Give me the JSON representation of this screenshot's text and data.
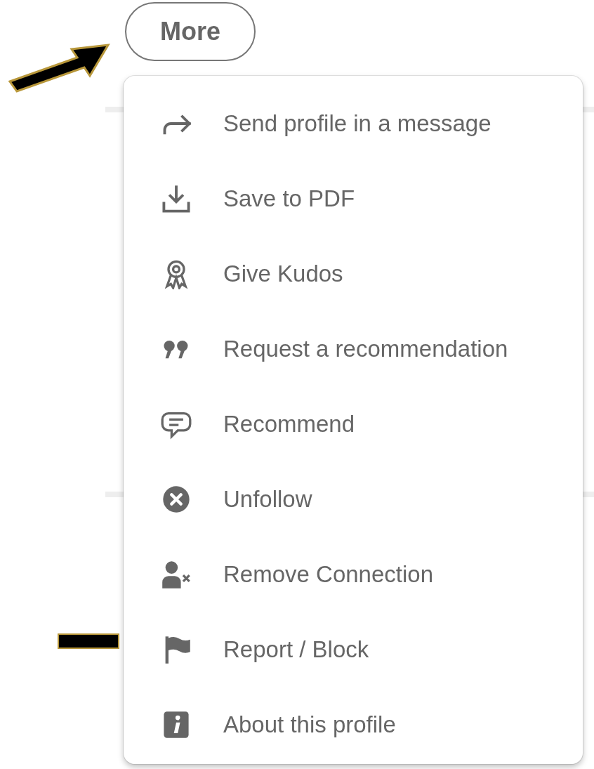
{
  "more_button": {
    "label": "More"
  },
  "menu": {
    "items": [
      {
        "label": "Send profile in a message"
      },
      {
        "label": "Save to PDF"
      },
      {
        "label": "Give Kudos"
      },
      {
        "label": "Request a recommendation"
      },
      {
        "label": "Recommend"
      },
      {
        "label": "Unfollow"
      },
      {
        "label": "Remove Connection"
      },
      {
        "label": "Report / Block"
      },
      {
        "label": "About this profile"
      }
    ]
  }
}
